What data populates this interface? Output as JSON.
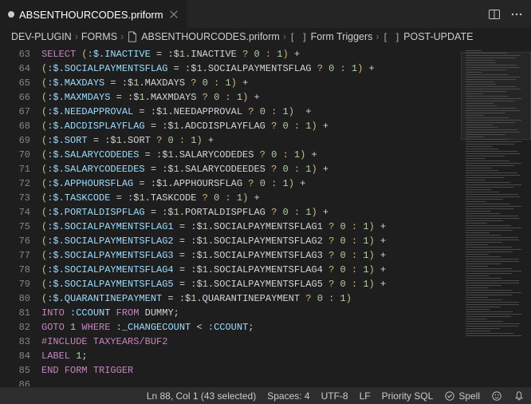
{
  "tab": {
    "title": "ABSENTHOURCODES.priform",
    "modified": true
  },
  "breadcrumb": {
    "root": "DEV-PLUGIN",
    "folder": "FORMS",
    "file": "ABSENTHOURCODES.priform",
    "section": "Form Triggers",
    "subsection": "POST-UPDATE"
  },
  "editor": {
    "first_line_no": 63,
    "lines": [
      {
        "n": 63,
        "pre": "",
        "raw": "SELECT (:$.INACTIVE = :$1.INACTIVE ? 0 : 1) +"
      },
      {
        "n": 64,
        "pre": "",
        "raw": "(:$.SOCIALPAYMENTSFLAG = :$1.SOCIALPAYMENTSFLAG ? 0 : 1) +"
      },
      {
        "n": 65,
        "pre": "",
        "raw": "(:$.MAXDAYS = :$1.MAXDAYS ? 0 : 1) +"
      },
      {
        "n": 66,
        "pre": "",
        "raw": "(:$.MAXMDAYS = :$1.MAXMDAYS ? 0 : 1) +"
      },
      {
        "n": 67,
        "pre": "",
        "raw": "(:$.NEEDAPPROVAL = :$1.NEEDAPPROVAL ? 0 : 1)  +"
      },
      {
        "n": 68,
        "pre": "",
        "raw": "(:$.ADCDISPLAYFLAG = :$1.ADCDISPLAYFLAG ? 0 : 1) +"
      },
      {
        "n": 69,
        "pre": "",
        "raw": "(:$.SORT = :$1.SORT ? 0 : 1) +"
      },
      {
        "n": 70,
        "pre": "",
        "raw": "(:$.SALARYCODEDES = :$1.SALARYCODEDES ? 0 : 1) +"
      },
      {
        "n": 71,
        "pre": "",
        "raw": "(:$.SALARYCODEEDES = :$1.SALARYCODEEDES ? 0 : 1) +"
      },
      {
        "n": 72,
        "pre": "",
        "raw": "(:$.APPHOURSFLAG = :$1.APPHOURSFLAG ? 0 : 1) +"
      },
      {
        "n": 73,
        "pre": "",
        "raw": "(:$.TASKCODE = :$1.TASKCODE ? 0 : 1) +"
      },
      {
        "n": 74,
        "pre": "",
        "raw": "(:$.PORTALDISPFLAG = :$1.PORTALDISPFLAG ? 0 : 1) +"
      },
      {
        "n": 75,
        "pre": "",
        "raw": "(:$.SOCIALPAYMENTSFLAG1 = :$1.SOCIALPAYMENTSFLAG1 ? 0 : 1) +"
      },
      {
        "n": 76,
        "pre": "",
        "raw": "(:$.SOCIALPAYMENTSFLAG2 = :$1.SOCIALPAYMENTSFLAG2 ? 0 : 1) +"
      },
      {
        "n": 77,
        "pre": "",
        "raw": "(:$.SOCIALPAYMENTSFLAG3 = :$1.SOCIALPAYMENTSFLAG3 ? 0 : 1) +"
      },
      {
        "n": 78,
        "pre": "",
        "raw": "(:$.SOCIALPAYMENTSFLAG4 = :$1.SOCIALPAYMENTSFLAG4 ? 0 : 1) +"
      },
      {
        "n": 79,
        "pre": "",
        "raw": "(:$.SOCIALPAYMENTSFLAG5 = :$1.SOCIALPAYMENTSFLAG5 ? 0 : 1) +"
      },
      {
        "n": 80,
        "pre": "",
        "raw": "(:$.QUARANTINEPAYMENT = :$1.QUARANTINEPAYMENT ? 0 : 1)"
      },
      {
        "n": 81,
        "pre": "",
        "raw": "INTO :CCOUNT FROM DUMMY;"
      },
      {
        "n": 82,
        "pre": "",
        "raw": "GOTO 1 WHERE :_CHANGECOUNT < :CCOUNT;"
      },
      {
        "n": 83,
        "pre": "",
        "raw": "#INCLUDE TAXYEARS/BUF2"
      },
      {
        "n": 84,
        "pre": "",
        "raw": "LABEL 1;"
      },
      {
        "n": 85,
        "pre": "",
        "raw": "END FORM TRIGGER"
      },
      {
        "n": 86,
        "pre": "",
        "raw": ""
      }
    ]
  },
  "status": {
    "cursor": "Ln 88, Col 1 (43 selected)",
    "spaces": "Spaces: 4",
    "encoding": "UTF-8",
    "eol": "LF",
    "language": "Priority SQL",
    "spell": "Spell",
    "feedback_icon": "smiley-icon",
    "bell_icon": "bell-icon"
  },
  "icons": {
    "split": "split-editor-icon",
    "more": "more-icon",
    "close": "close-icon"
  }
}
